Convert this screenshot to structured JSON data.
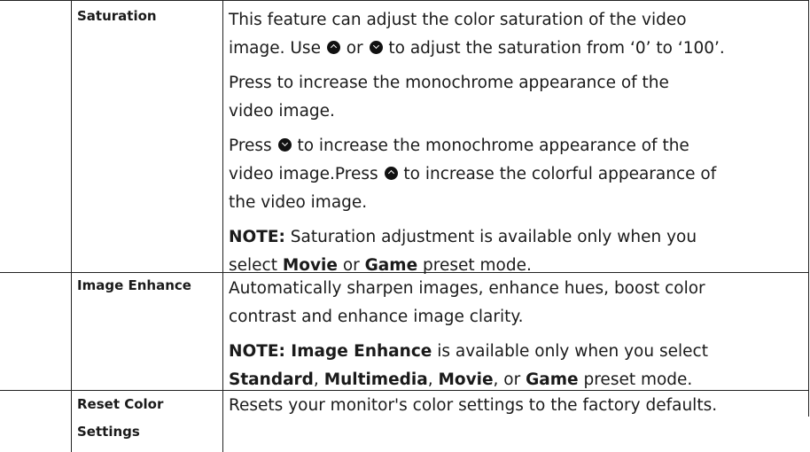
{
  "rows": [
    {
      "label": "Saturation",
      "p1": [
        "This feature can adjust the color saturation of the video",
        "image. Use ",
        " or ",
        " to adjust the saturation from ‘0’ to ‘100’."
      ],
      "p2": [
        "Press  to increase the monochrome appearance of the",
        "video image."
      ],
      "p3": [
        "Press ",
        " to increase the monochrome appearance of the",
        "video image.Press ",
        " to increase the colorful appearance of",
        "the video image."
      ],
      "note": {
        "lead": "NOTE:",
        "l1": " Saturation adjustment is available only when you",
        "l2a": "select ",
        "b1": "Movie",
        "mid": " or ",
        "b2": "Game",
        "end": " preset mode."
      }
    },
    {
      "label": "Image Enhance",
      "p1": [
        "Automatically sharpen images, enhance hues, boost color",
        "contrast and enhance image clarity."
      ],
      "note": {
        "lead": "NOTE: Image Enhance",
        "l1": " is available only when you select",
        "b1": "Standard",
        "s1": ", ",
        "b2": "Multimedia",
        "s2": ", ",
        "b3": "Movie",
        "s3": ", or ",
        "b4": "Game",
        "end": " preset mode."
      }
    },
    {
      "label_l1": "Reset Color",
      "label_l2": "Settings",
      "p1": "Resets your monitor's color settings to the factory defaults."
    }
  ],
  "icons": [
    "up-button-icon",
    "down-button-icon"
  ]
}
